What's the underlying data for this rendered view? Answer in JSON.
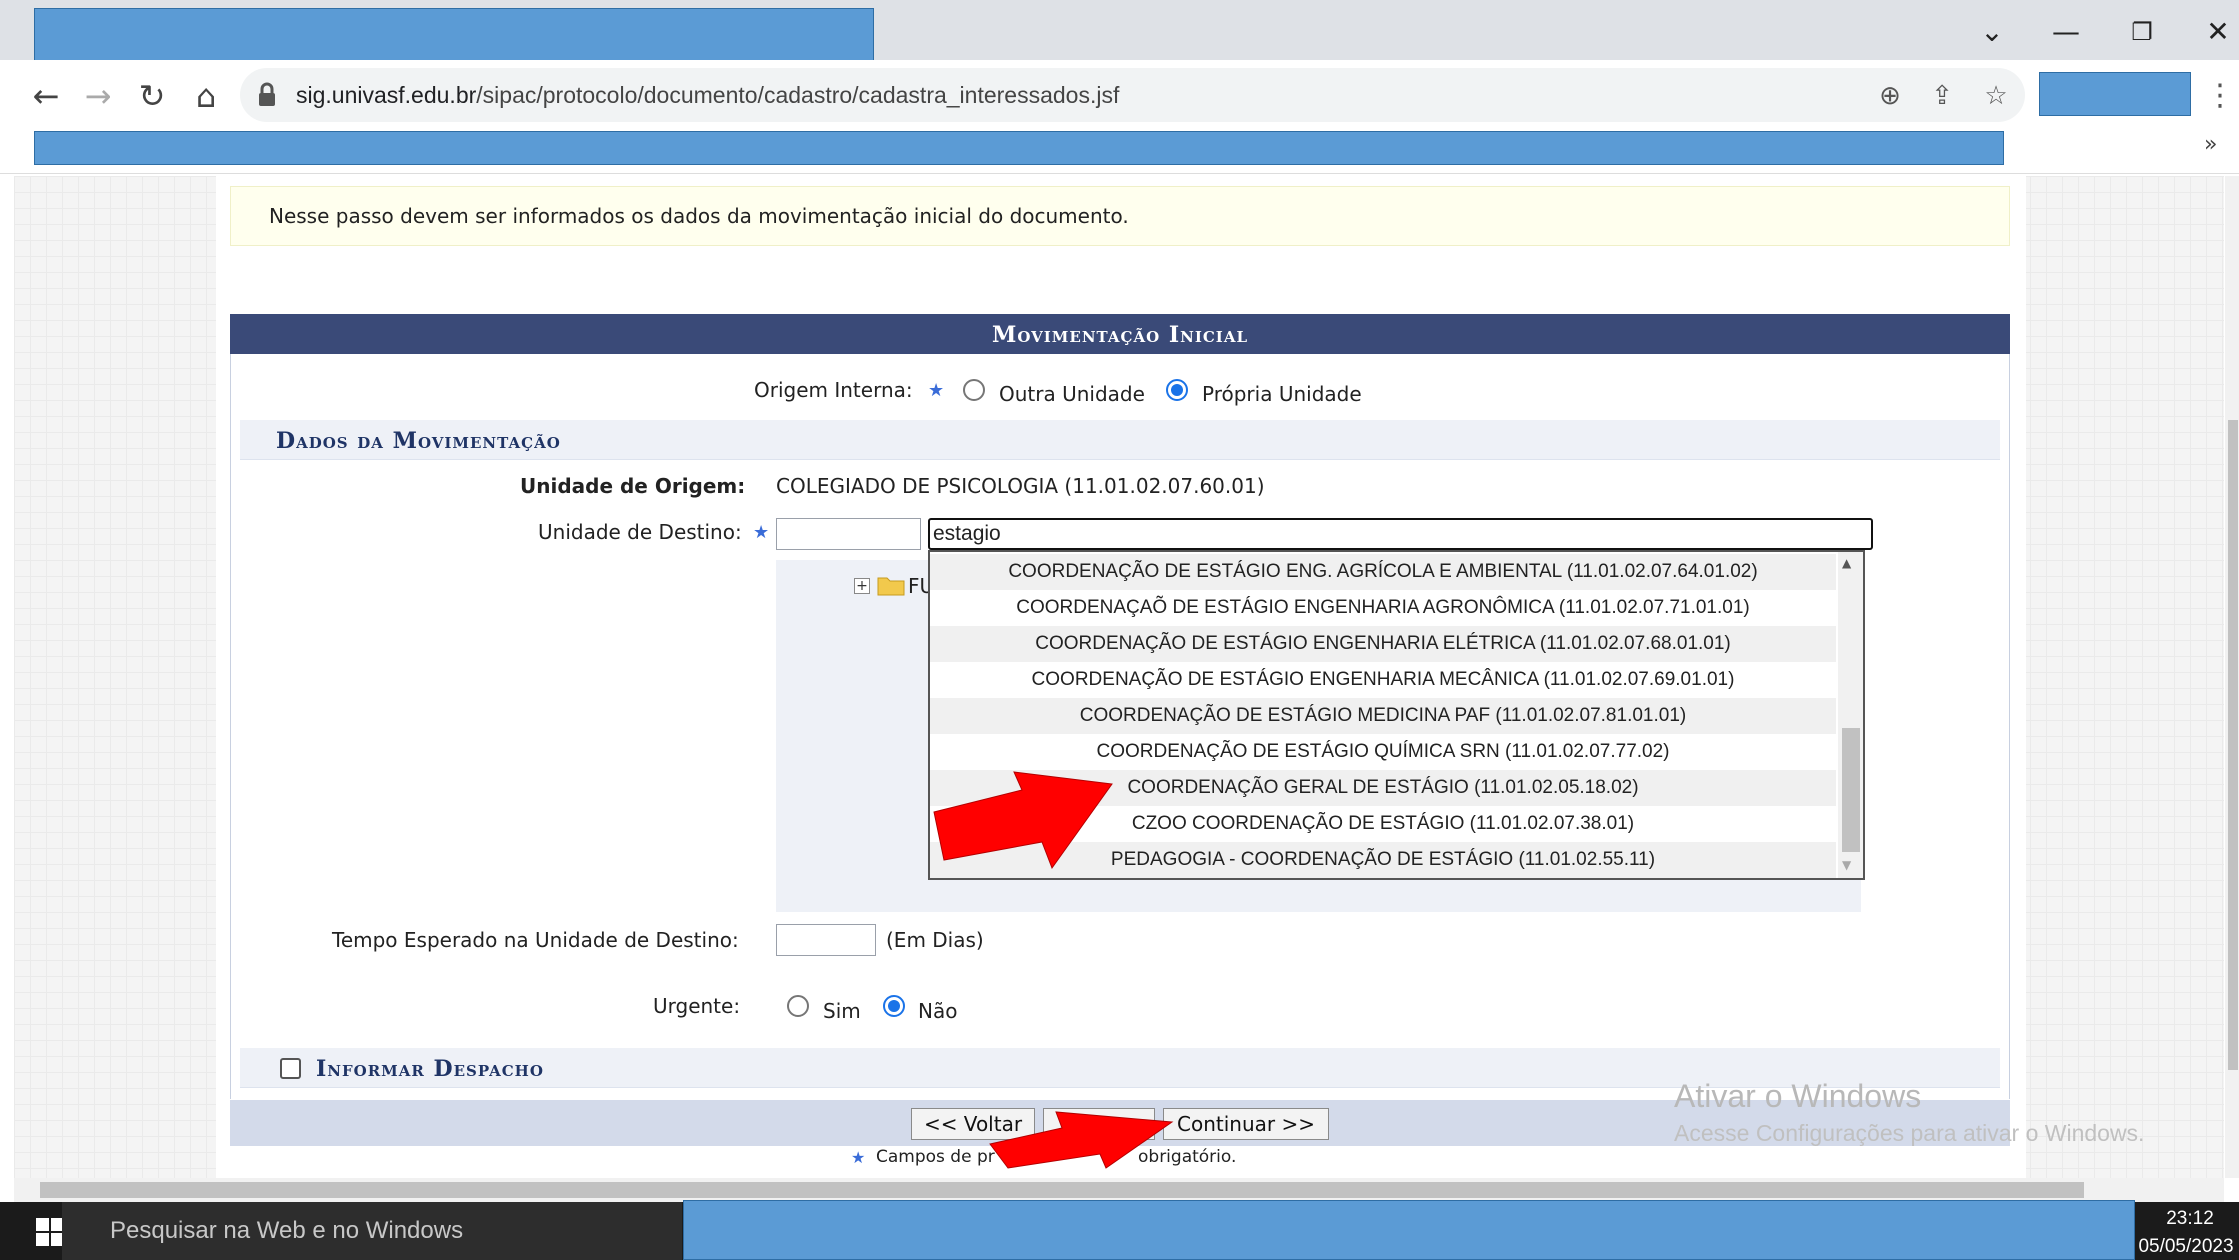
{
  "browser": {
    "url_domain": "sig.univasf.edu.br",
    "url_path": "/sipac/protocolo/documento/cadastro/cadastra_interessados.jsf",
    "icons": [
      "back-arrow",
      "forward-arrow",
      "reload",
      "home",
      "lock",
      "zoom",
      "share",
      "star",
      "menu-dots",
      "chevron-down",
      "minimize",
      "restore",
      "close",
      "chevron-right-double"
    ]
  },
  "page": {
    "info_text": "Nesse passo devem ser informados os dados da movimentação inicial do documento.",
    "form_title": "Movimentação Inicial",
    "origem_label": "Origem Interna:",
    "origem_options": [
      "Outra Unidade",
      "Própria Unidade"
    ],
    "origem_selected": "Própria Unidade",
    "section_title": "Dados da Movimentação",
    "unidade_origem_label": "Unidade de Origem:",
    "unidade_origem_value": "COLEGIADO DE PSICOLOGIA (11.01.02.07.60.01)",
    "unidade_destino_label": "Unidade de Destino:",
    "unidade_destino_code": "",
    "unidade_destino_search": "estagio",
    "tree_folder_label": "FU",
    "dropdown_items": [
      "COORDENAÇÃO DE ESTÁGIO ENG. AGRÍCOLA E AMBIENTAL (11.01.02.07.64.01.02)",
      "COORDENAÇAÕ DE ESTÁGIO ENGENHARIA AGRONÔMICA (11.01.02.07.71.01.01)",
      "COORDENAÇÃO DE ESTÁGIO ENGENHARIA ELÉTRICA (11.01.02.07.68.01.01)",
      "COORDENAÇÃO DE ESTÁGIO ENGENHARIA MECÂNICA (11.01.02.07.69.01.01)",
      "COORDENAÇÃO DE ESTÁGIO MEDICINA PAF (11.01.02.07.81.01.01)",
      "COORDENAÇÃO DE ESTÁGIO QUÍMICA SRN (11.01.02.07.77.02)",
      "COORDENAÇÃO GERAL DE ESTÁGIO (11.01.02.05.18.02)",
      "CZOO COORDENAÇÃO DE ESTÁGIO (11.01.02.07.38.01)",
      "PEDAGOGIA - COORDENAÇÃO DE ESTÁGIO (11.01.02.55.11)"
    ],
    "tempo_label": "Tempo Esperado na Unidade de Destino:",
    "tempo_value": "",
    "tempo_unit": "(Em Dias)",
    "urgente_label": "Urgente:",
    "urgente_options": [
      "Sim",
      "Não"
    ],
    "urgente_selected": "Não",
    "despacho_label": "Informar Despacho",
    "despacho_checked": false,
    "btn_voltar": "<< Voltar",
    "btn_continuar": "Continuar >>",
    "required_note": "Campos de pr",
    "required_note_end": "obrigatório."
  },
  "watermark": {
    "line1": "Ativar o Windows",
    "line2": "Acesse Configurações para ativar o Windows."
  },
  "taskbar": {
    "search_placeholder": "Pesquisar na Web e no Windows",
    "time": "23:12",
    "date": "05/05/2023"
  },
  "colors": {
    "header_bg": "#3a4a78",
    "section_bg": "#eef1f7",
    "info_bg": "#ffffee",
    "arrow": "#ff0000",
    "redaction": "#5b9bd5"
  }
}
